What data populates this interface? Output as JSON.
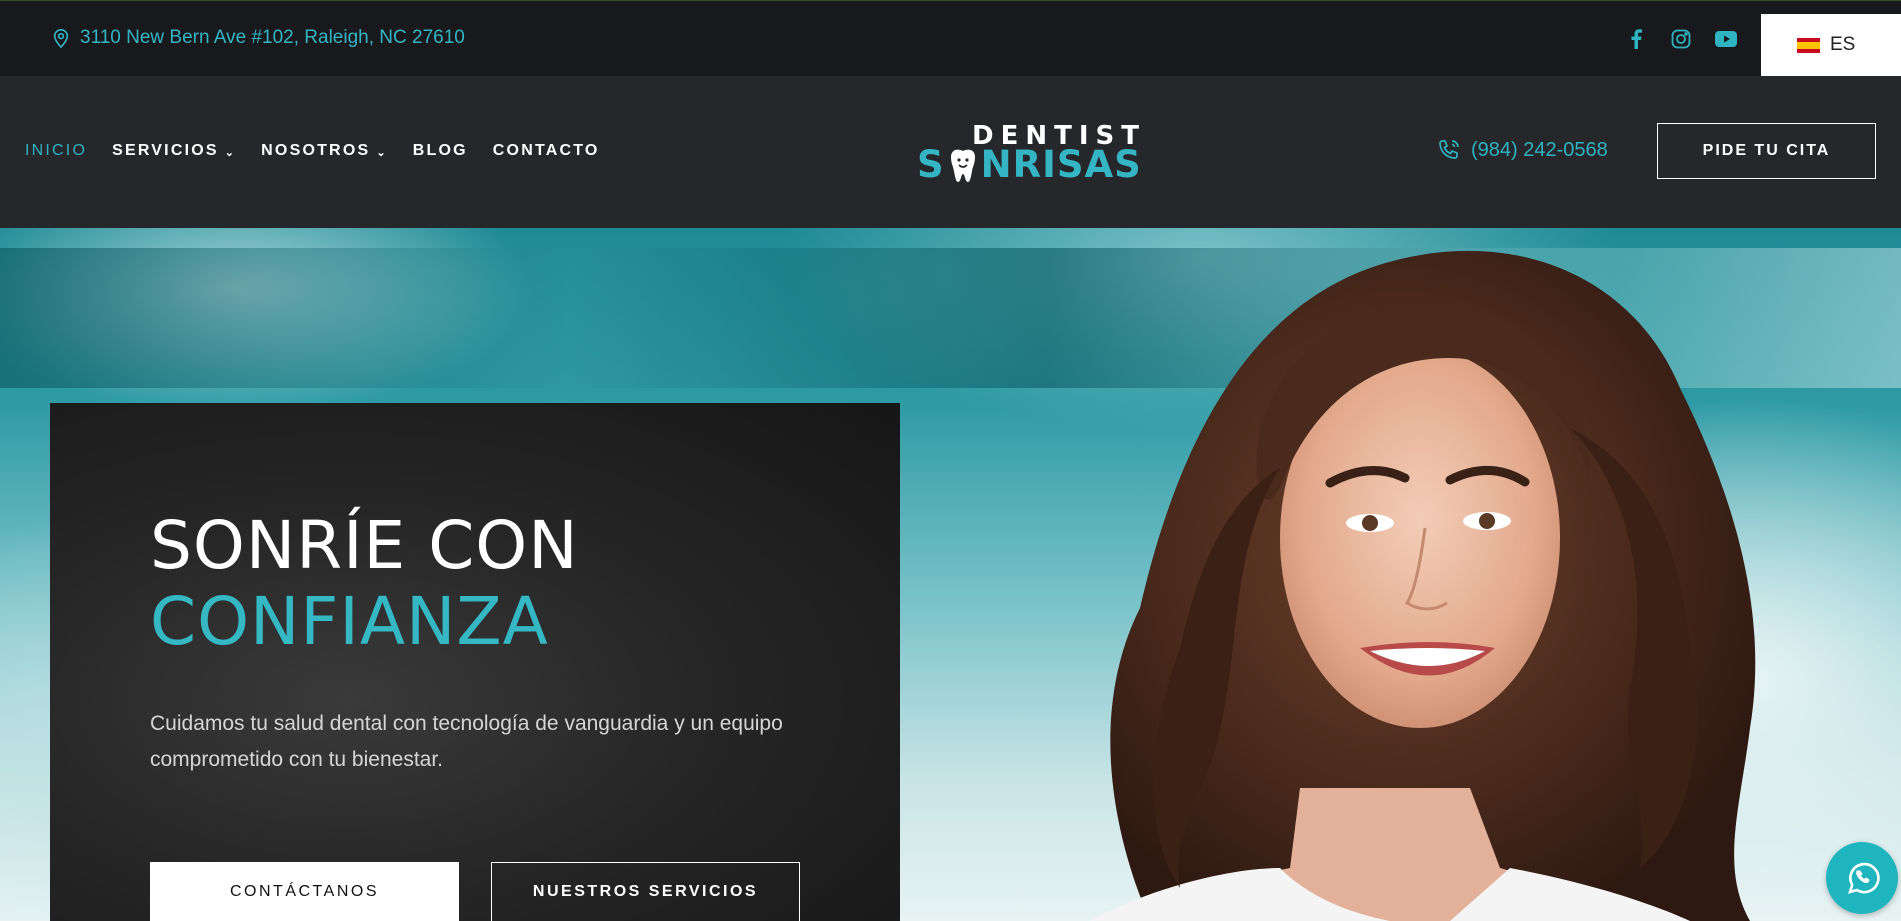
{
  "topbar": {
    "address": "3110 New Bern Ave #102, Raleigh, NC 27610",
    "social": [
      {
        "icon": "facebook-icon"
      },
      {
        "icon": "instagram-icon"
      },
      {
        "icon": "youtube-icon"
      }
    ],
    "language": "ES"
  },
  "nav": {
    "items": [
      {
        "label": "INICIO",
        "active": true
      },
      {
        "label": "SERVICIOS",
        "dropdown": true
      },
      {
        "label": "NOSOTROS",
        "dropdown": true
      },
      {
        "label": "BLOG"
      },
      {
        "label": "CONTACTO"
      }
    ],
    "logo_top": "DENTIST",
    "logo_s": "S",
    "logo_rest": "NRISAS",
    "phone": "(984) 242-0568",
    "cta": "PIDE TU CITA"
  },
  "hero": {
    "title_line1": "SONRÍE CON",
    "title_line2": "CONFIANZA",
    "description": "Cuidamos tu salud dental con tecnología de vanguardia y un equipo comprometido con tu bienestar.",
    "primary_button": "CONTÁCTANOS",
    "secondary_button": "NUESTROS SERVICIOS"
  },
  "colors": {
    "accent": "#2fb3c1",
    "topbar_bg": "#17191c",
    "nav_bg": "#25272b"
  }
}
